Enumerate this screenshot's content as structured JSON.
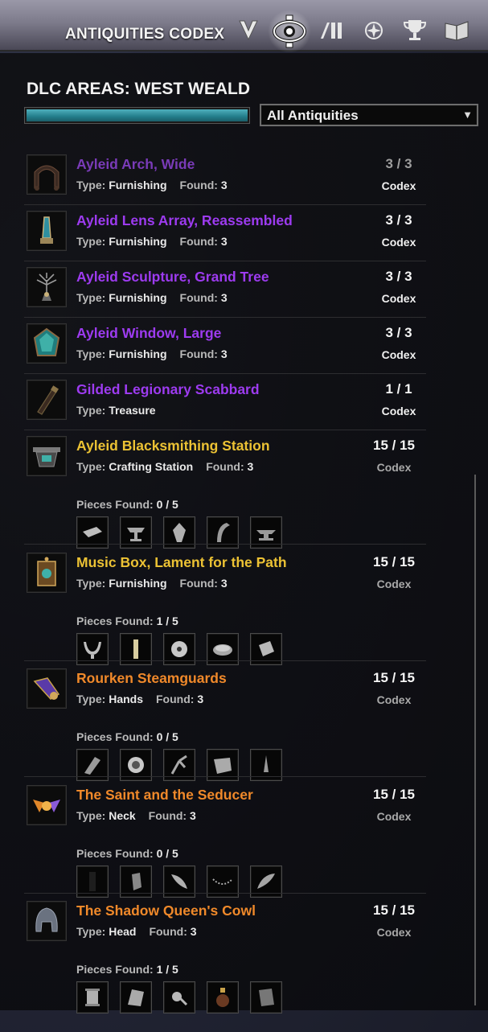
{
  "header": {
    "title": "ANTIQUITIES CODEX",
    "tabs": [
      {
        "icon": "scrying-icon"
      },
      {
        "icon": "codex-eye-icon",
        "active": true
      },
      {
        "icon": "leads-icon"
      },
      {
        "icon": "skill-icon"
      },
      {
        "icon": "trophy-icon"
      },
      {
        "icon": "book-icon"
      }
    ]
  },
  "area": {
    "title": "DLC AREAS: WEST WEALD",
    "progress_fraction": 1.0
  },
  "filter": {
    "selected": "All Antiquities",
    "arrow": "▼"
  },
  "entries": [
    {
      "name": "Ayleid Arch, Wide",
      "type_label": "Type:",
      "type": "Furnishing",
      "found_label": "Found:",
      "found": "3",
      "count": "3 / 3",
      "codex": "Codex",
      "color": "#9d3bf0"
    },
    {
      "name": "Ayleid Lens Array, Reassembled",
      "type_label": "Type:",
      "type": "Furnishing",
      "found_label": "Found:",
      "found": "3",
      "count": "3 / 3",
      "codex": "Codex",
      "color": "#9d3bf0"
    },
    {
      "name": "Ayleid Sculpture, Grand Tree",
      "type_label": "Type:",
      "type": "Furnishing",
      "found_label": "Found:",
      "found": "3",
      "count": "3 / 3",
      "codex": "Codex",
      "color": "#9d3bf0"
    },
    {
      "name": "Ayleid Window, Large",
      "type_label": "Type:",
      "type": "Furnishing",
      "found_label": "Found:",
      "found": "3",
      "count": "3 / 3",
      "codex": "Codex",
      "color": "#9d3bf0"
    },
    {
      "name": "Gilded Legionary Scabbard",
      "type_label": "Type:",
      "type": "Treasure",
      "count": "1 / 1",
      "codex": "Codex",
      "color": "#9d3bf0"
    },
    {
      "name": "Ayleid Blacksmithing Station",
      "type_label": "Type:",
      "type": "Crafting Station",
      "found_label": "Found:",
      "found": "3",
      "count": "15 / 15",
      "codex": "Codex",
      "color": "#ecc234",
      "pieces_label": "Pieces Found:",
      "pieces": "0 / 5"
    },
    {
      "name": "Music Box, Lament for the Path",
      "type_label": "Type:",
      "type": "Furnishing",
      "found_label": "Found:",
      "found": "3",
      "count": "15 / 15",
      "codex": "Codex",
      "color": "#ecc234",
      "pieces_label": "Pieces Found:",
      "pieces": "1 / 5"
    },
    {
      "name": "Rourken Steamguards",
      "type_label": "Type:",
      "type": "Hands",
      "found_label": "Found:",
      "found": "3",
      "count": "15 / 15",
      "codex": "Codex",
      "color": "#f0892a",
      "pieces_label": "Pieces Found:",
      "pieces": "0 / 5"
    },
    {
      "name": "The Saint and the Seducer",
      "type_label": "Type:",
      "type": "Neck",
      "found_label": "Found:",
      "found": "3",
      "count": "15 / 15",
      "codex": "Codex",
      "color": "#f0892a",
      "pieces_label": "Pieces Found:",
      "pieces": "0 / 5"
    },
    {
      "name": "The Shadow Queen's Cowl",
      "type_label": "Type:",
      "type": "Head",
      "found_label": "Found:",
      "found": "3",
      "count": "15 / 15",
      "codex": "Codex",
      "color": "#f0892a",
      "pieces_label": "Pieces Found:",
      "pieces": "1 / 5"
    }
  ]
}
